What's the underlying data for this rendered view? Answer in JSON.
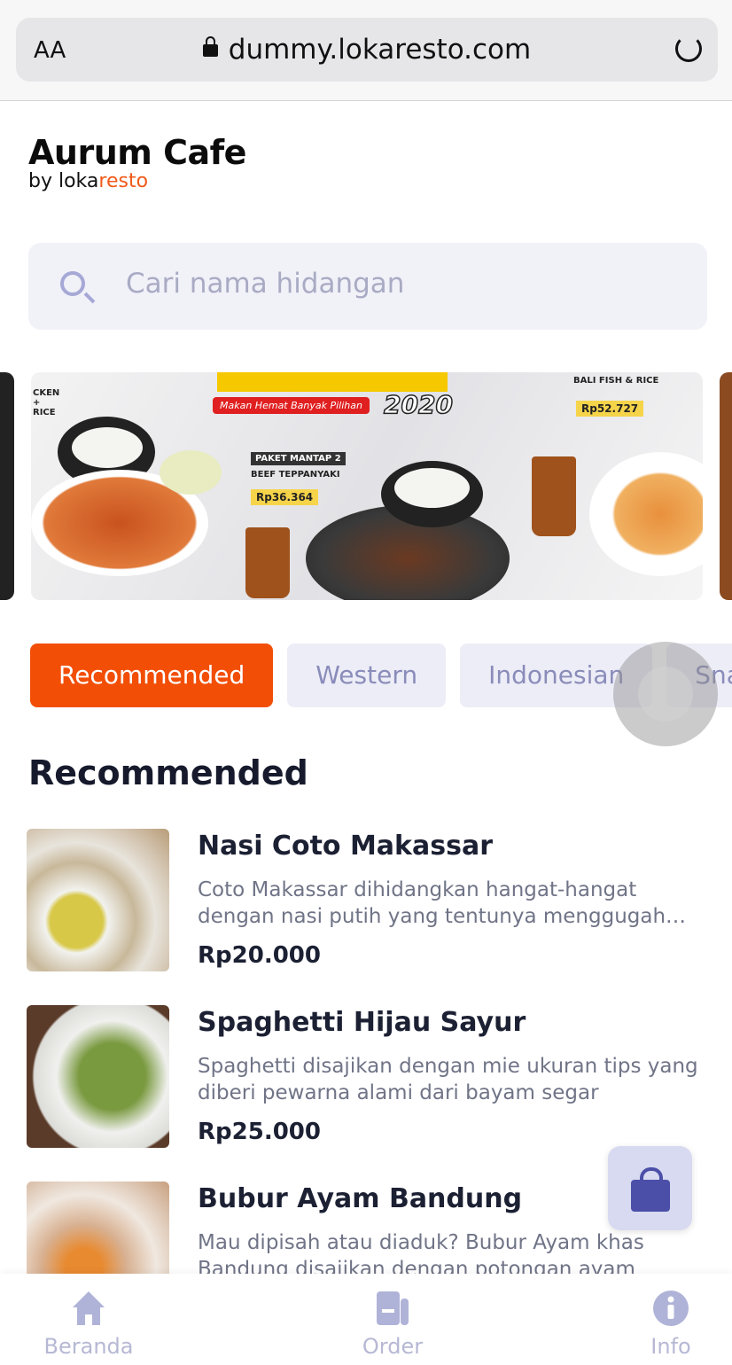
{
  "browser": {
    "text_size_label": "AA",
    "url": "dummy.lokaresto.com"
  },
  "brand": {
    "name": "Aurum Cafe",
    "by": "by",
    "provider_dark": "loka",
    "provider_accent": "resto",
    "accent": "#f05a1a"
  },
  "search": {
    "placeholder": "Cari nama hidangan",
    "value": ""
  },
  "banner": {
    "tagline": "Makan Hemat Banyak Pilihan",
    "year": "2020",
    "left_label": "CKEN + RICE",
    "pkg_label": "PAKET MANTAP 2",
    "pkg_name": "BEEF TEPPANYAKI",
    "pkg_price": "Rp36.364",
    "right_name": "BALI FISH & RICE",
    "right_price": "Rp52.727"
  },
  "categories": [
    {
      "label": "Recommended",
      "active": true
    },
    {
      "label": "Western"
    },
    {
      "label": "Indonesian"
    },
    {
      "label": "Snack"
    }
  ],
  "section_title": "Recommended",
  "items": [
    {
      "name": "Nasi Coto Makassar",
      "desc": "Coto Makassar dihidangkan hangat-hangat dengan nasi putih yang tentunya menggugah selera",
      "price": "Rp20.000"
    },
    {
      "name": "Spaghetti Hijau Sayur",
      "desc": "Spaghetti disajikan dengan mie ukuran tips yang diberi pewarna alami dari bayam segar",
      "price": "Rp25.000"
    },
    {
      "name": "Bubur Ayam Bandung",
      "desc": "Mau dipisah atau diaduk? Bubur Ayam khas Bandung disajikan dengan potongan ayam",
      "price": ""
    }
  ],
  "cart": {
    "icon": "shopping-bag-icon"
  },
  "nav": [
    {
      "label": "Beranda",
      "icon": "home-icon"
    },
    {
      "label": "Order",
      "icon": "order-icon"
    },
    {
      "label": "Info",
      "icon": "info-icon"
    }
  ]
}
